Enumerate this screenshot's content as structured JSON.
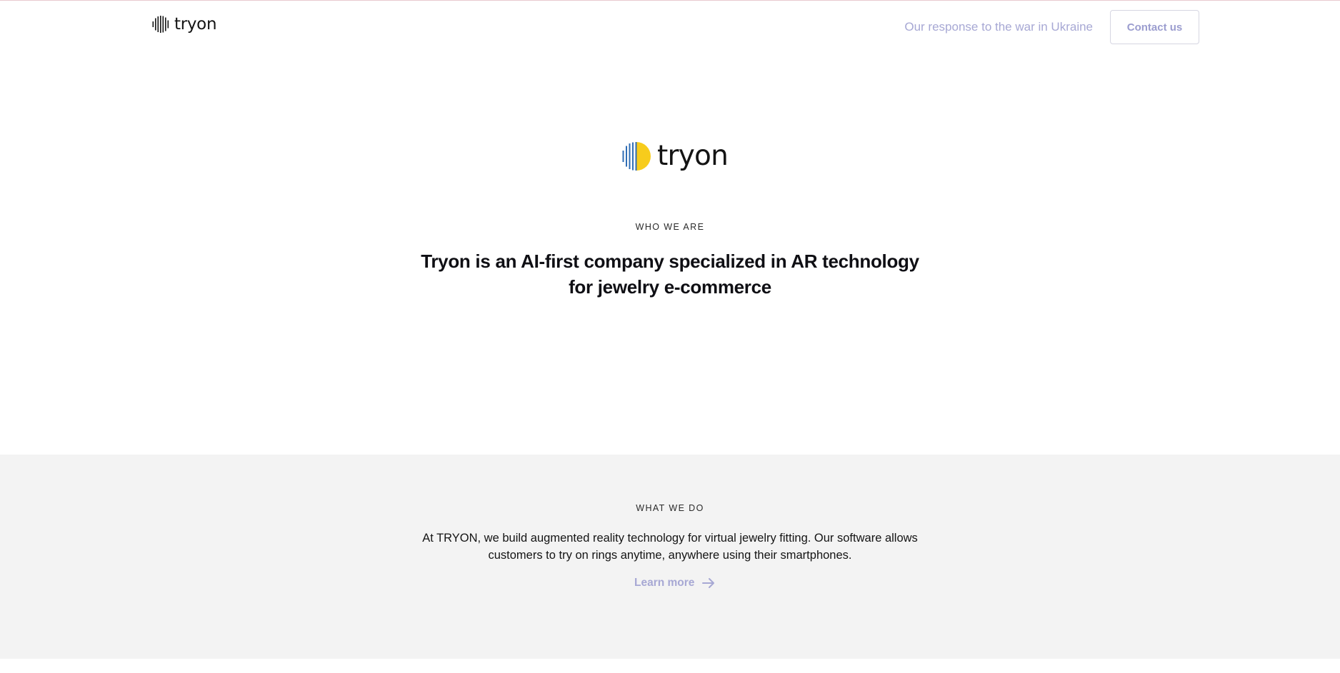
{
  "nav": {
    "brand": "tryon",
    "ukraine_link": "Our response to the war in Ukraine",
    "contact_button": "Contact us"
  },
  "hero": {
    "brand": "tryon",
    "eyebrow": "WHO WE ARE",
    "title": "Tryon is an AI-first company specialized in AR technology for jewelry e-commerce"
  },
  "what_we_do": {
    "eyebrow": "WHAT WE DO",
    "text": "At TRYON, we build augmented reality technology for virtual jewelry fitting. Our software allows customers to try on rings anytime, anywhere using their smartphones.",
    "learn_more": "Learn more"
  },
  "colors": {
    "accent": "#a7a8d4",
    "logo_blue": "#2f6db5",
    "logo_yellow": "#f7cc1c",
    "section_bg": "#f3f3f3"
  },
  "icons": {
    "nav_logo": "tryon-logo-black",
    "hero_logo": "tryon-logo-ukraine-colors",
    "learn_more": "arrow-right-icon"
  }
}
